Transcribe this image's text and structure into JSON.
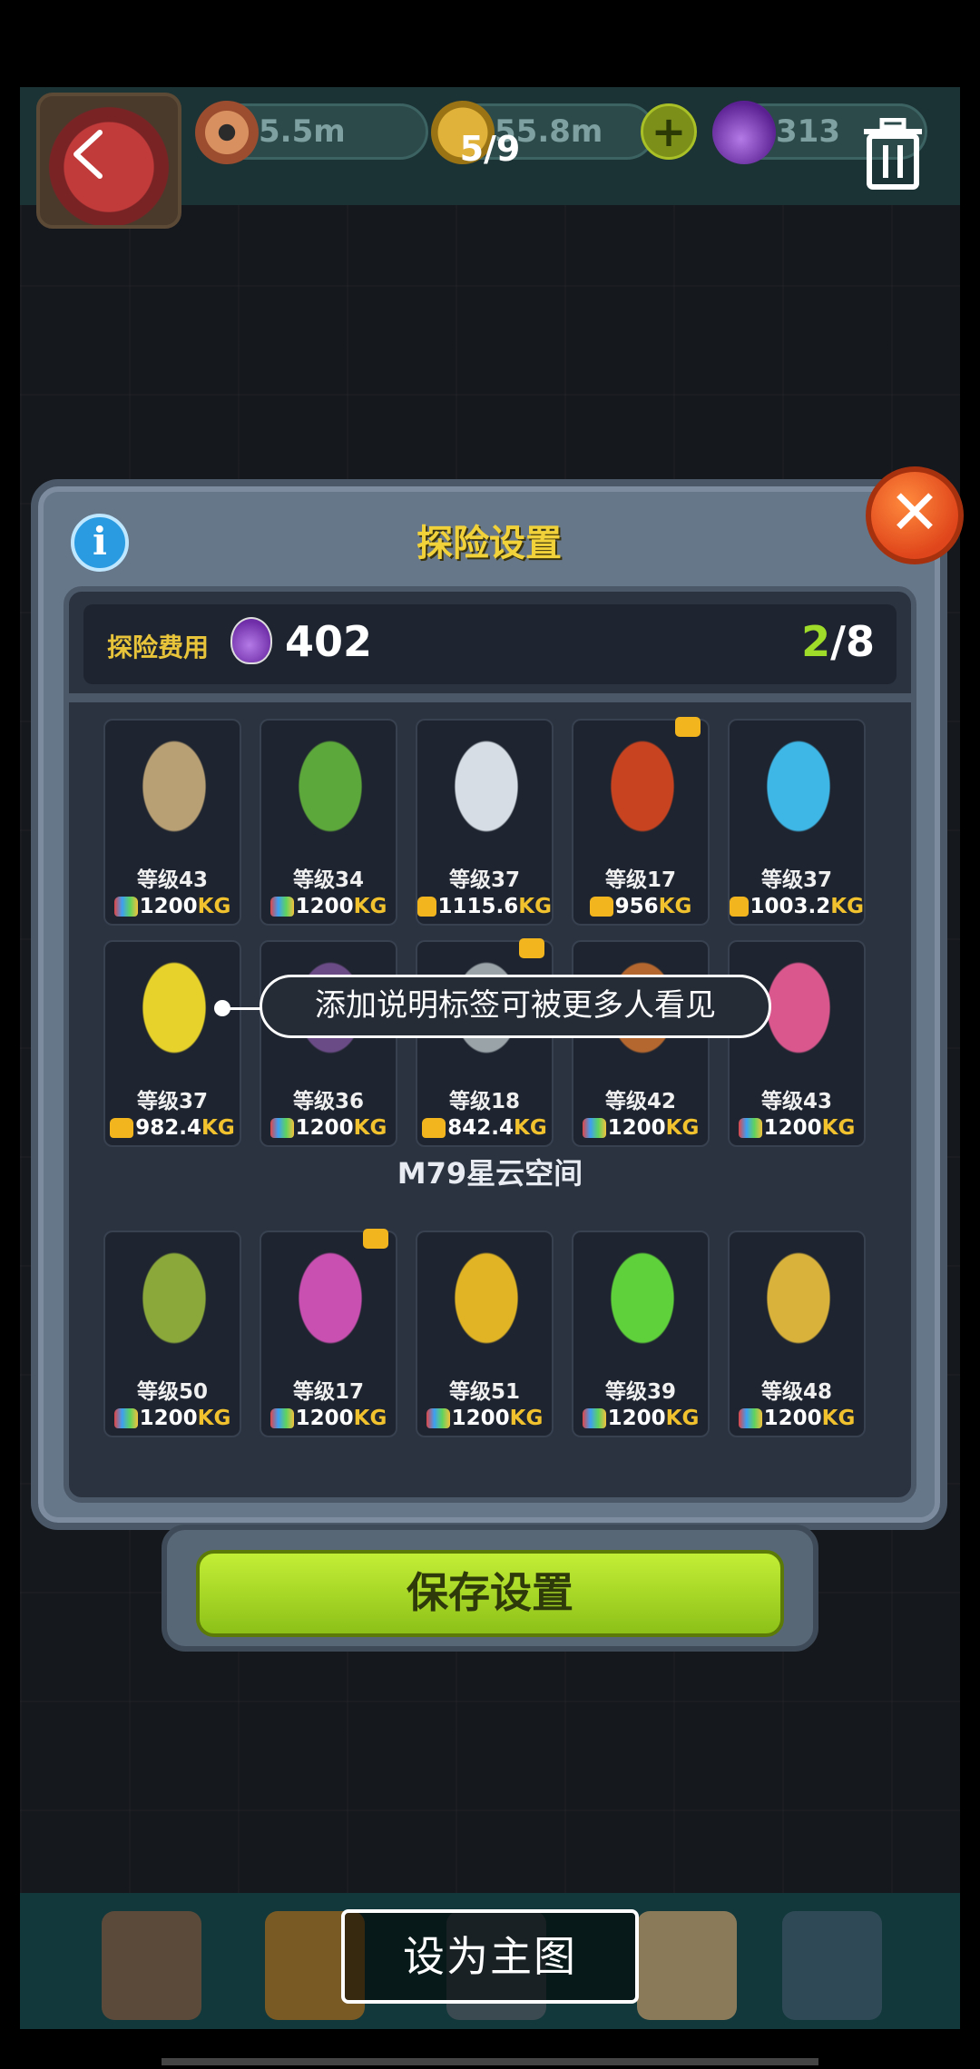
{
  "viewer": {
    "counter": "5/9",
    "set_main_label": "设为主图"
  },
  "game_header": {
    "resources": [
      {
        "icon": "eyeball-icon",
        "value": "5.5m"
      },
      {
        "icon": "coin-icon",
        "value": "55.8m"
      },
      {
        "icon": "potion-icon",
        "value": "313"
      }
    ]
  },
  "dialog": {
    "title": "探险设置",
    "cost_label": "探险费用",
    "cost_value": "402",
    "slots_used": "2",
    "slots_sep": "/",
    "slots_total": "8",
    "save_label": "保存设置",
    "section_title": "M79星云空间"
  },
  "tooltip": "添加说明标签可被更多人看见",
  "cards_top": [
    {
      "level": "等级43",
      "weight": "1200",
      "unit": "KG",
      "bag": "multi",
      "crown": false,
      "color": "#b9a074"
    },
    {
      "level": "等级34",
      "weight": "1200",
      "unit": "KG",
      "bag": "multi",
      "crown": false,
      "color": "#5da83a"
    },
    {
      "level": "等级37",
      "weight": "1115.6",
      "unit": "KG",
      "bag": "gold",
      "crown": false,
      "color": "#d7dde4"
    },
    {
      "level": "等级17",
      "weight": "956",
      "unit": "KG",
      "bag": "gold",
      "crown": true,
      "color": "#c8431f"
    },
    {
      "level": "等级37",
      "weight": "1003.2",
      "unit": "KG",
      "bag": "gold",
      "crown": false,
      "color": "#3fb7e6"
    },
    {
      "level": "等级37",
      "weight": "982.4",
      "unit": "KG",
      "bag": "gold",
      "crown": false,
      "color": "#e6d22a"
    },
    {
      "level": "等级36",
      "weight": "1200",
      "unit": "KG",
      "bag": "multi",
      "crown": false,
      "color": "#6a4b86"
    },
    {
      "level": "等级18",
      "weight": "842.4",
      "unit": "KG",
      "bag": "gold",
      "crown": true,
      "color": "#9aa3a8"
    },
    {
      "level": "等级42",
      "weight": "1200",
      "unit": "KG",
      "bag": "multi",
      "crown": false,
      "color": "#b4672e"
    },
    {
      "level": "等级43",
      "weight": "1200",
      "unit": "KG",
      "bag": "multi",
      "crown": false,
      "color": "#d9578d"
    }
  ],
  "cards_bottom": [
    {
      "level": "等级50",
      "weight": "1200",
      "unit": "KG",
      "bag": "multi",
      "crown": false,
      "color": "#8aa93a"
    },
    {
      "level": "等级17",
      "weight": "1200",
      "unit": "KG",
      "bag": "multi",
      "crown": true,
      "color": "#c94fb0"
    },
    {
      "level": "等级51",
      "weight": "1200",
      "unit": "KG",
      "bag": "multi",
      "crown": false,
      "color": "#e0b424"
    },
    {
      "level": "等级39",
      "weight": "1200",
      "unit": "KG",
      "bag": "multi",
      "crown": false,
      "color": "#5fd13a"
    },
    {
      "level": "等级48",
      "weight": "1200",
      "unit": "KG",
      "bag": "multi",
      "crown": false,
      "color": "#d8b23a"
    }
  ]
}
